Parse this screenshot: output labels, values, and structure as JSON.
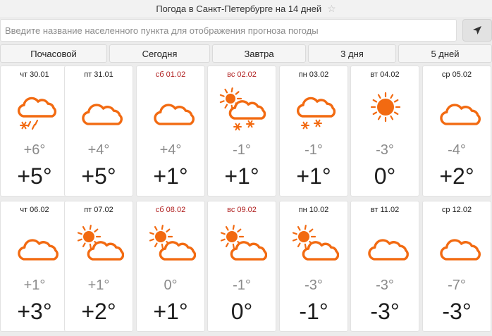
{
  "header": {
    "title": "Погода в Санкт-Петербурге на 14 дней"
  },
  "search": {
    "placeholder": "Введите название населенного пункта для отображения прогноза погоды"
  },
  "tabs": [
    {
      "label": "Почасовой"
    },
    {
      "label": "Сегодня"
    },
    {
      "label": "Завтра"
    },
    {
      "label": "3 дня"
    },
    {
      "label": "5 дней"
    }
  ],
  "colors": {
    "icon": "#f26a11",
    "weekend": "#b01f1f",
    "min_temp": "#8a8a8a"
  },
  "days": [
    {
      "date": "чт 30.01",
      "weekend": false,
      "icon": "cloud-snow-rain-icon",
      "min": "+6°",
      "max": "+5°"
    },
    {
      "date": "пт 31.01",
      "weekend": false,
      "icon": "cloudy-icon",
      "min": "+4°",
      "max": "+5°"
    },
    {
      "date": "сб 01.02",
      "weekend": true,
      "icon": "cloudy-icon",
      "min": "+4°",
      "max": "+1°"
    },
    {
      "date": "вс 02.02",
      "weekend": true,
      "icon": "partly-cloudy-snow-icon",
      "min": "-1°",
      "max": "+1°"
    },
    {
      "date": "пн 03.02",
      "weekend": false,
      "icon": "cloud-snow-icon",
      "min": "-1°",
      "max": "+1°"
    },
    {
      "date": "вт 04.02",
      "weekend": false,
      "icon": "sun-icon",
      "min": "-3°",
      "max": "0°"
    },
    {
      "date": "ср 05.02",
      "weekend": false,
      "icon": "cloudy-icon",
      "min": "-4°",
      "max": "+2°"
    },
    {
      "date": "чт 06.02",
      "weekend": false,
      "icon": "cloudy-icon",
      "min": "+1°",
      "max": "+3°"
    },
    {
      "date": "пт 07.02",
      "weekend": false,
      "icon": "partly-cloudy-icon",
      "min": "+1°",
      "max": "+2°"
    },
    {
      "date": "сб 08.02",
      "weekend": true,
      "icon": "partly-cloudy-icon",
      "min": "0°",
      "max": "+1°"
    },
    {
      "date": "вс 09.02",
      "weekend": true,
      "icon": "partly-cloudy-icon",
      "min": "-1°",
      "max": "0°"
    },
    {
      "date": "пн 10.02",
      "weekend": false,
      "icon": "partly-cloudy-icon",
      "min": "-3°",
      "max": "-1°"
    },
    {
      "date": "вт 11.02",
      "weekend": false,
      "icon": "cloudy-icon",
      "min": "-3°",
      "max": "-3°"
    },
    {
      "date": "ср 12.02",
      "weekend": false,
      "icon": "cloudy-icon",
      "min": "-7°",
      "max": "-3°"
    }
  ]
}
